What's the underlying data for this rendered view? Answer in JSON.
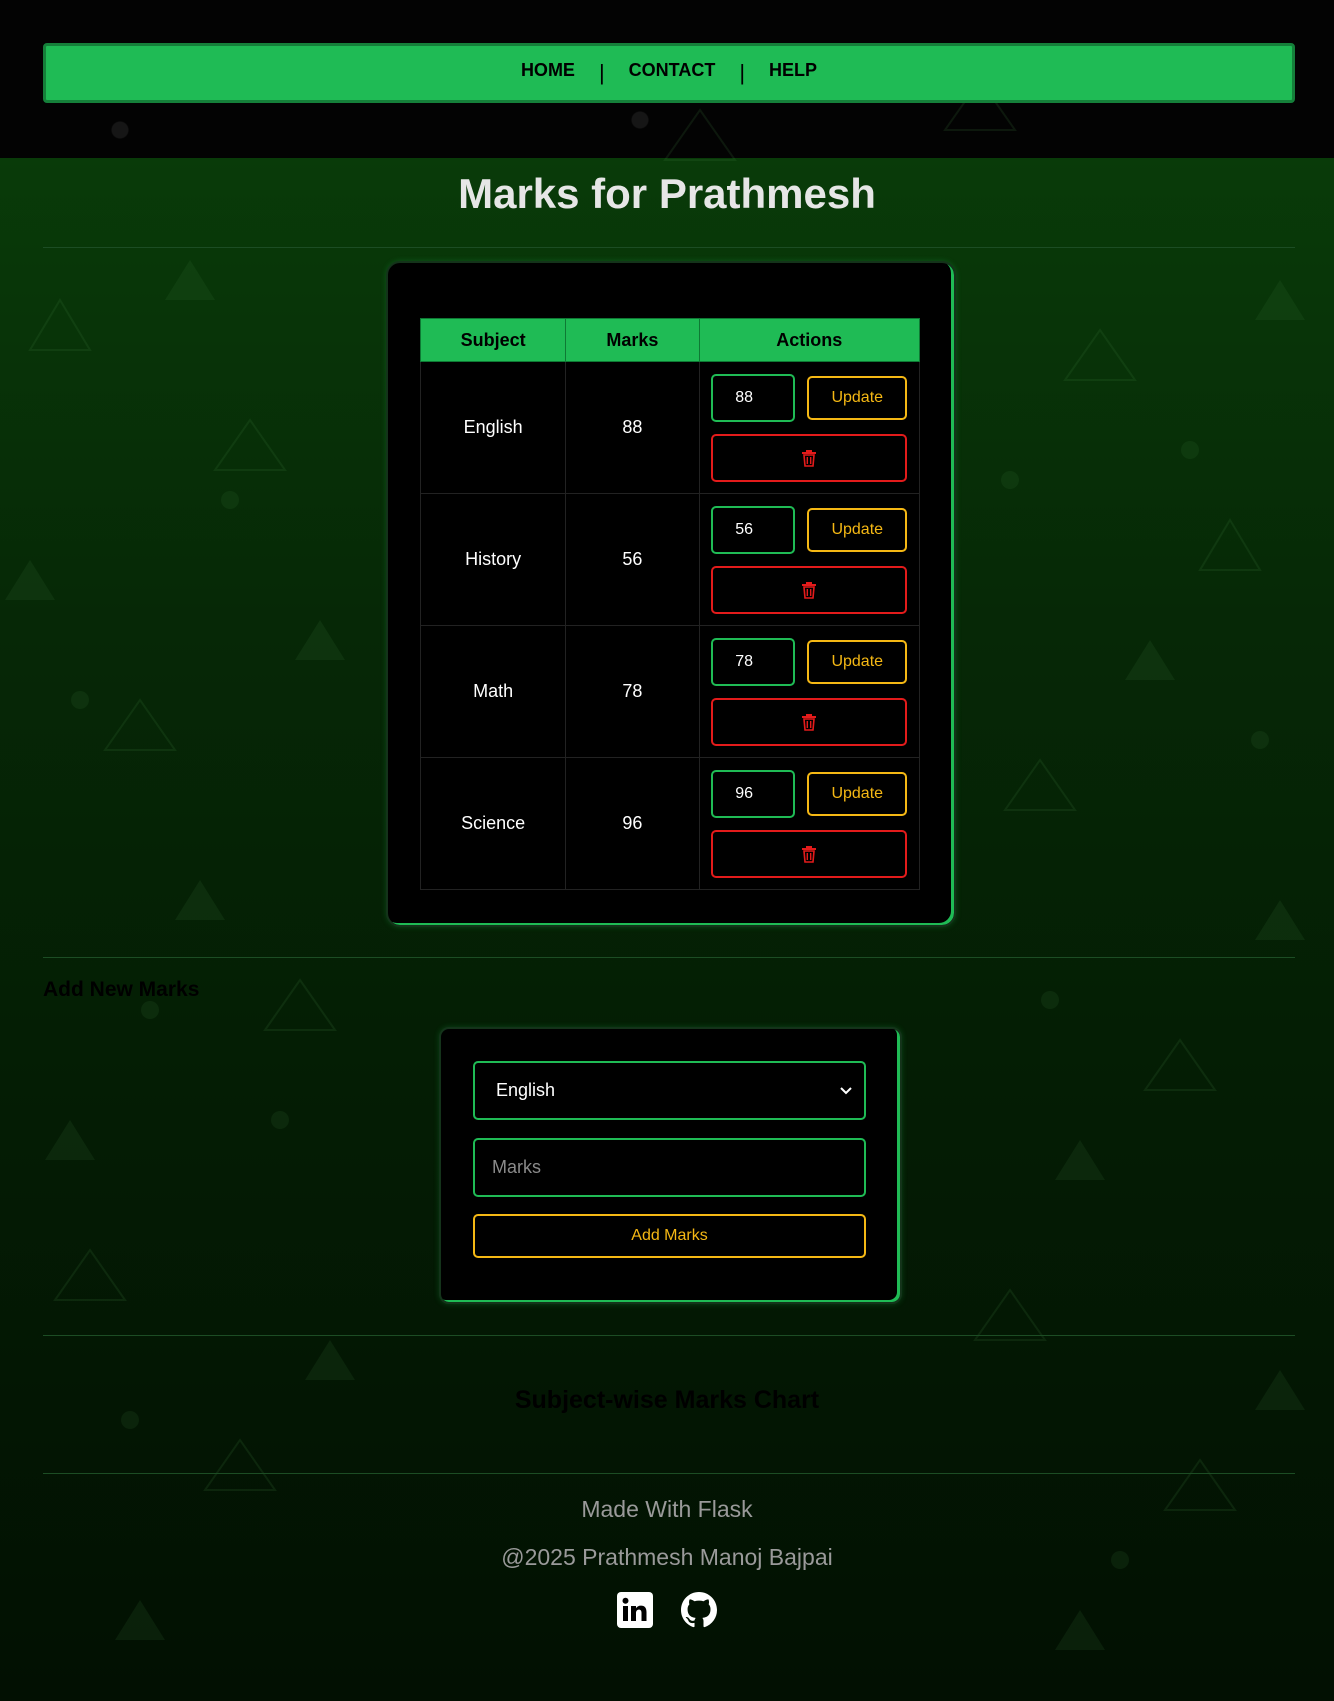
{
  "nav": {
    "items": [
      {
        "label": "HOME"
      },
      {
        "label": "CONTACT"
      },
      {
        "label": "HELP"
      }
    ],
    "separator": "|"
  },
  "page": {
    "title": "Marks for Prathmesh"
  },
  "marks_table": {
    "headers": {
      "subject": "Subject",
      "marks": "Marks",
      "actions": "Actions"
    },
    "rows": [
      {
        "subject": "English",
        "marks": "88",
        "input_value": "88"
      },
      {
        "subject": "History",
        "marks": "56",
        "input_value": "56"
      },
      {
        "subject": "Math",
        "marks": "78",
        "input_value": "78"
      },
      {
        "subject": "Science",
        "marks": "96",
        "input_value": "96"
      }
    ],
    "update_label": "Update",
    "delete_icon": "trash-icon"
  },
  "add_section": {
    "heading": "Add New Marks",
    "selected_subject": "English",
    "marks_placeholder": "Marks",
    "button_label": "Add Marks"
  },
  "chart_section": {
    "heading": "Subject-wise Marks Chart"
  },
  "footer": {
    "line1": "Made With Flask",
    "line2": "@2025 Prathmesh Manoj Bajpai",
    "icons": [
      "linkedin-icon",
      "github-icon"
    ]
  },
  "colors": {
    "accent_green": "#1fbb55",
    "update_yellow": "#f5b814",
    "delete_red": "#e31b1b",
    "background": "#062806"
  }
}
